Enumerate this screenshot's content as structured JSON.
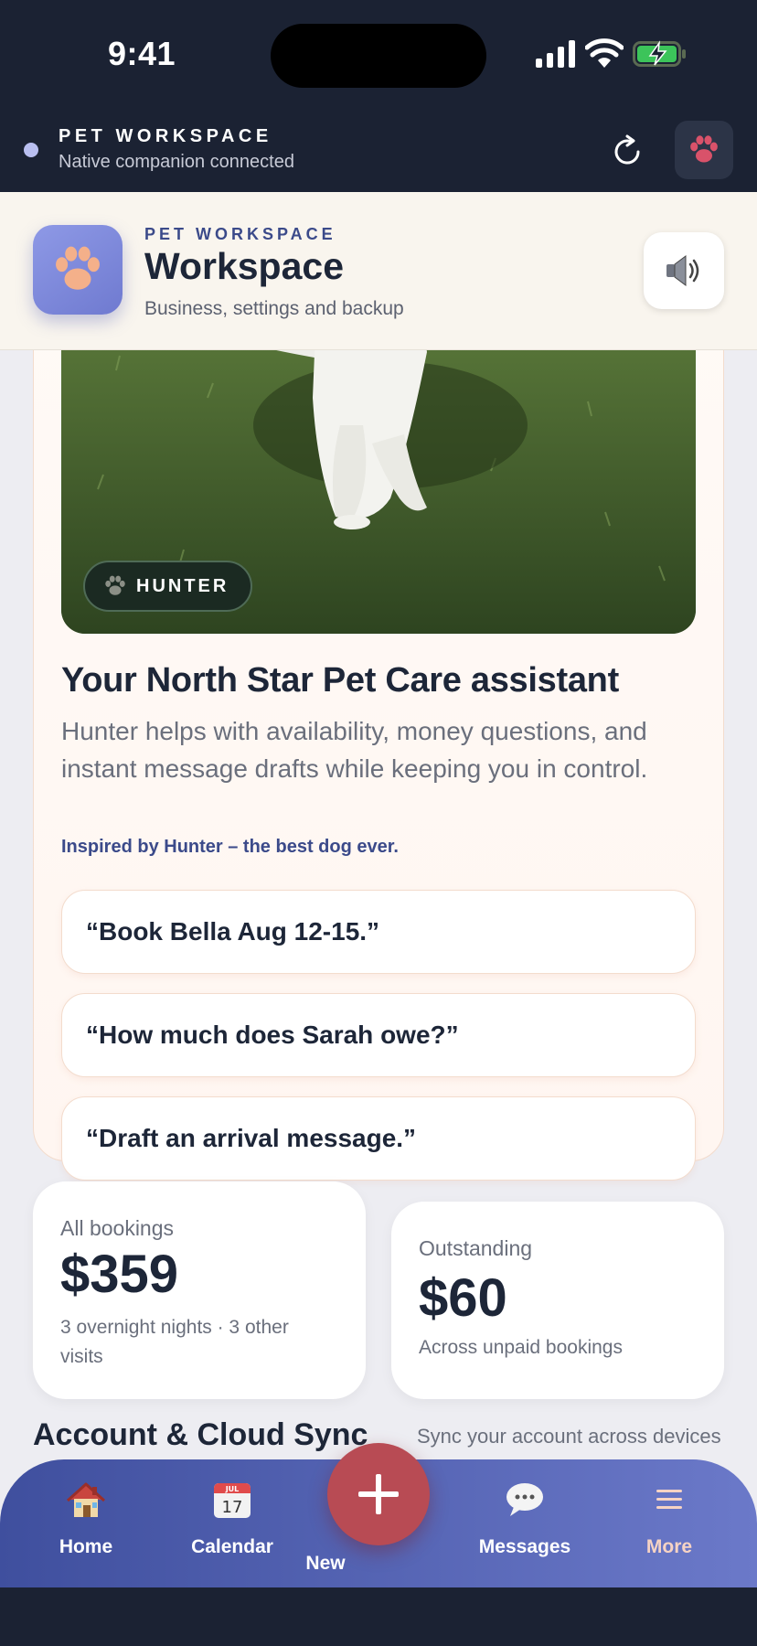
{
  "status_bar": {
    "time": "9:41"
  },
  "companion": {
    "title": "PET WORKSPACE",
    "status": "Native companion connected"
  },
  "header": {
    "eyebrow": "PET WORKSPACE",
    "title": "Workspace",
    "subtitle": "Business, settings and backup"
  },
  "assistant": {
    "badge": "HUNTER",
    "title": "Your North Star Pet Care assistant",
    "description": "Hunter helps with availability, money questions, and instant message drafts while keeping you in control.",
    "inspired": "Inspired by Hunter – the best dog ever.",
    "prompts": [
      "“Book Bella Aug 12-15.”",
      "“How much does Sarah owe?”",
      "“Draft an arrival message.”"
    ]
  },
  "stats": {
    "bookings": {
      "label": "All bookings",
      "value": "$359",
      "sub": "3 overnight nights · 3 other visits"
    },
    "outstanding": {
      "label": "Outstanding",
      "value": "$60",
      "sub": "Across unpaid bookings"
    }
  },
  "next_section": {
    "title": "Account & Cloud Sync",
    "link": "Sync your account across devices"
  },
  "tabs": [
    {
      "label": "Home",
      "icon": "house-icon"
    },
    {
      "label": "Calendar",
      "icon": "calendar-icon"
    },
    {
      "label": "New",
      "icon": "plus-icon"
    },
    {
      "label": "Messages",
      "icon": "speech-bubble-icon"
    },
    {
      "label": "More",
      "icon": "menu-icon"
    }
  ],
  "calendar_icon": {
    "month": "JUL",
    "day": "17"
  },
  "colors": {
    "navy": "#1b2233",
    "accent_blue": "#3b4a8a",
    "tab_gradient_start": "#3f4f9e",
    "tab_gradient_end": "#6b79c9",
    "fab_red": "#b84b54",
    "paw_peach": "#f4b08a",
    "more_active": "#f6d3c4"
  }
}
